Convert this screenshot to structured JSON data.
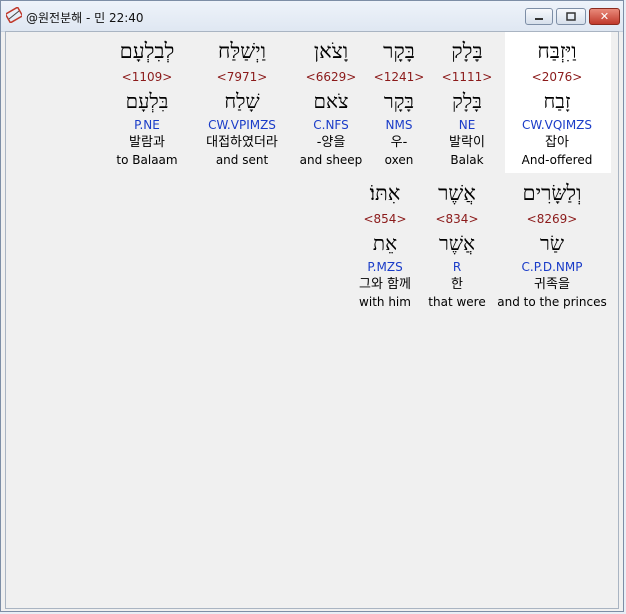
{
  "window": {
    "title": "@원전분해 - 민 22:40",
    "close_glyph": "✕"
  },
  "words_row1": [
    {
      "heb": "וַיִּזְבַּח",
      "strong": "<2076>",
      "root": "זָבַח",
      "morph": "CW.VQIMZS",
      "kor": "잡아",
      "eng": "And-offered"
    },
    {
      "heb": "בָּלָק",
      "strong": "<1111>",
      "root": "בָּלָק",
      "morph": "NE",
      "kor": "발락이",
      "eng": "Balak"
    },
    {
      "heb": "בָּקָר",
      "strong": "<1241>",
      "root": "בָּקָר",
      "morph": "NMS",
      "kor": "우-",
      "eng": "oxen"
    },
    {
      "heb": "וָצֹאן",
      "strong": "<6629>",
      "root": "צֹאם",
      "morph": "C.NFS",
      "kor": "-양을",
      "eng": "and sheep"
    },
    {
      "heb": "וַיְשַׁלַּח",
      "strong": "<7971>",
      "root": "שָׁלַח",
      "morph": "CW.VPIMZS",
      "kor": "대접하였더라",
      "eng": "and sent"
    },
    {
      "heb": "לְבִלְעָם",
      "strong": "<1109>",
      "root": "בִּלְעָם",
      "morph": "P.NE",
      "kor": "발람과",
      "eng": "to Balaam"
    }
  ],
  "words_row2": [
    {
      "heb": "וְלַשָּׂרִים",
      "strong": "<8269>",
      "root": "שַׂר",
      "morph": "C.P.D.NMP",
      "kor": "귀족을",
      "eng": "and to the princes"
    },
    {
      "heb": "אֲשֶׁר",
      "strong": "<834>",
      "root": "אֲשֶׁר",
      "morph": "R",
      "kor": "한",
      "eng": "that were"
    },
    {
      "heb": "אִתּוֹ׃",
      "strong": "<854>",
      "root": "אֵת",
      "morph": "P.MZS",
      "kor": "그와 함께",
      "eng": "with him"
    }
  ]
}
